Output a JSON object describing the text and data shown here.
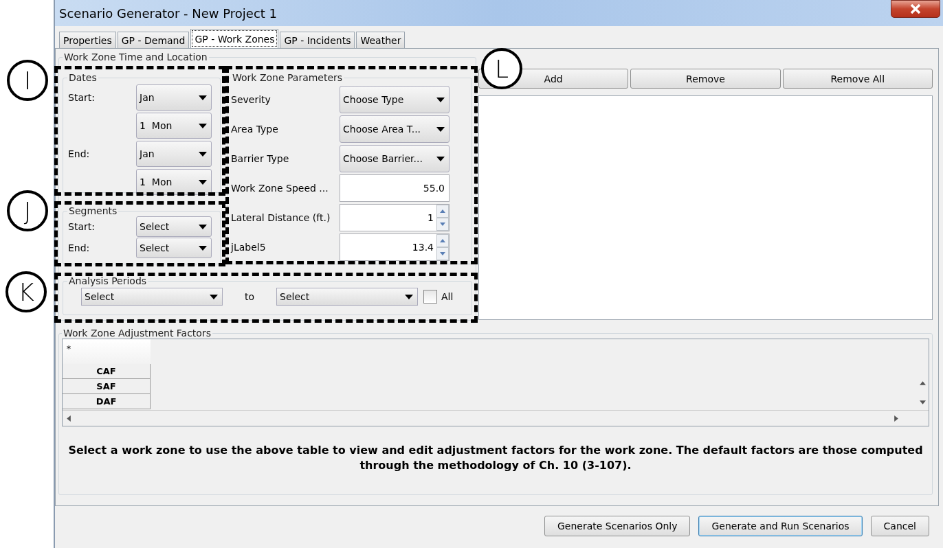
{
  "window": {
    "title": "Scenario Generator - New Project 1"
  },
  "tabs": [
    {
      "label": "Properties",
      "selected": false
    },
    {
      "label": "GP - Demand",
      "selected": false
    },
    {
      "label": "GP - Work Zones",
      "selected": true
    },
    {
      "label": "GP - Incidents",
      "selected": false
    },
    {
      "label": "Weather",
      "selected": false
    }
  ],
  "time_location": {
    "title": "Work Zone Time and Location",
    "dates": {
      "title": "Dates",
      "start_label": "Start:",
      "start_month": "Jan",
      "start_day": "1  Mon",
      "end_label": "End:",
      "end_month": "Jan",
      "end_day": "1  Mon"
    },
    "segments": {
      "title": "Segments",
      "start_label": "Start:",
      "start": "Select",
      "end_label": "End:",
      "end": "Select"
    }
  },
  "parameters": {
    "title": "Work Zone Parameters",
    "rows": [
      {
        "kind": "combo",
        "label": "Severity",
        "value": "Choose Type"
      },
      {
        "kind": "combo",
        "label": "Area Type",
        "value": "Choose Area T..."
      },
      {
        "kind": "combo",
        "label": "Barrier Type",
        "value": "Choose Barrier..."
      },
      {
        "kind": "text",
        "label": "Work Zone Speed ...",
        "value": "55.0"
      },
      {
        "kind": "spinner",
        "label": "Lateral Distance (ft.)",
        "value": "1"
      },
      {
        "kind": "spinner",
        "label": "jLabel5",
        "value": "13.4"
      }
    ]
  },
  "analysis_periods": {
    "title": "Analysis Periods",
    "from": "Select",
    "to_label": "to",
    "to": "Select",
    "all": {
      "label": "All",
      "checked": false
    }
  },
  "zone_list": {
    "buttons": [
      "Add",
      "Remove",
      "Remove All"
    ]
  },
  "adjustment_factors": {
    "title": "Work Zone Adjustment Factors",
    "corner": "*",
    "rows": [
      "CAF",
      "SAF",
      "DAF"
    ],
    "note": "Select a work zone to use the above table to view and edit adjustment factors for the work zone. The default factors are those computed through the methodology of Ch. 10 (3-107)."
  },
  "footer_buttons": [
    {
      "label": "Generate Scenarios Only",
      "default": false
    },
    {
      "label": "Generate and Run Scenarios",
      "default": true
    },
    {
      "label": "Cancel",
      "default": false
    }
  ],
  "annotations": [
    {
      "label": "I"
    },
    {
      "label": "J"
    },
    {
      "label": "K"
    },
    {
      "label": "L"
    }
  ]
}
